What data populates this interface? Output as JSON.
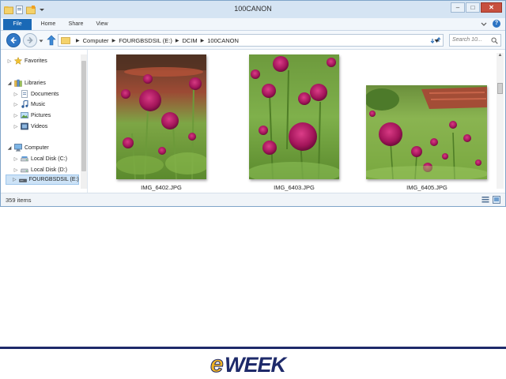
{
  "window": {
    "title": "100CANON",
    "controls": {
      "minimize": "–",
      "maximize": "□",
      "close": "✕"
    }
  },
  "ribbon": {
    "tabs": [
      {
        "label": "File"
      },
      {
        "label": "Home"
      },
      {
        "label": "Share"
      },
      {
        "label": "View"
      }
    ],
    "help_icon": "?"
  },
  "address": {
    "breadcrumbs": [
      "Computer",
      "FOURGBSDSIL (E:)",
      "DCIM",
      "100CANON"
    ],
    "separator": "▶"
  },
  "search": {
    "placeholder": "Search 10..."
  },
  "nav": {
    "favorites": "Favorites",
    "libraries": "Libraries",
    "library_items": [
      "Documents",
      "Music",
      "Pictures",
      "Videos"
    ],
    "computer": "Computer",
    "drives": [
      "Local Disk (C:)",
      "Local Disk (D:)",
      "FOURGBSDSIL (E:)"
    ]
  },
  "files": [
    {
      "name": "IMG_6402.JPG"
    },
    {
      "name": "IMG_6403.JPG"
    },
    {
      "name": "IMG_6405.JPG"
    }
  ],
  "status": {
    "item_count": "359 items"
  },
  "brand": {
    "logo_text": "eWEEK"
  },
  "colors": {
    "accent": "#1a69b6",
    "window_frame": "#cfe0f1",
    "selection": "#cde3f7",
    "flower": "#a3155a",
    "foliage": "#6c9a3a",
    "footer_line": "#1e2a6a",
    "logo_gold": "#f0b323",
    "logo_navy": "#1e2a6a"
  }
}
